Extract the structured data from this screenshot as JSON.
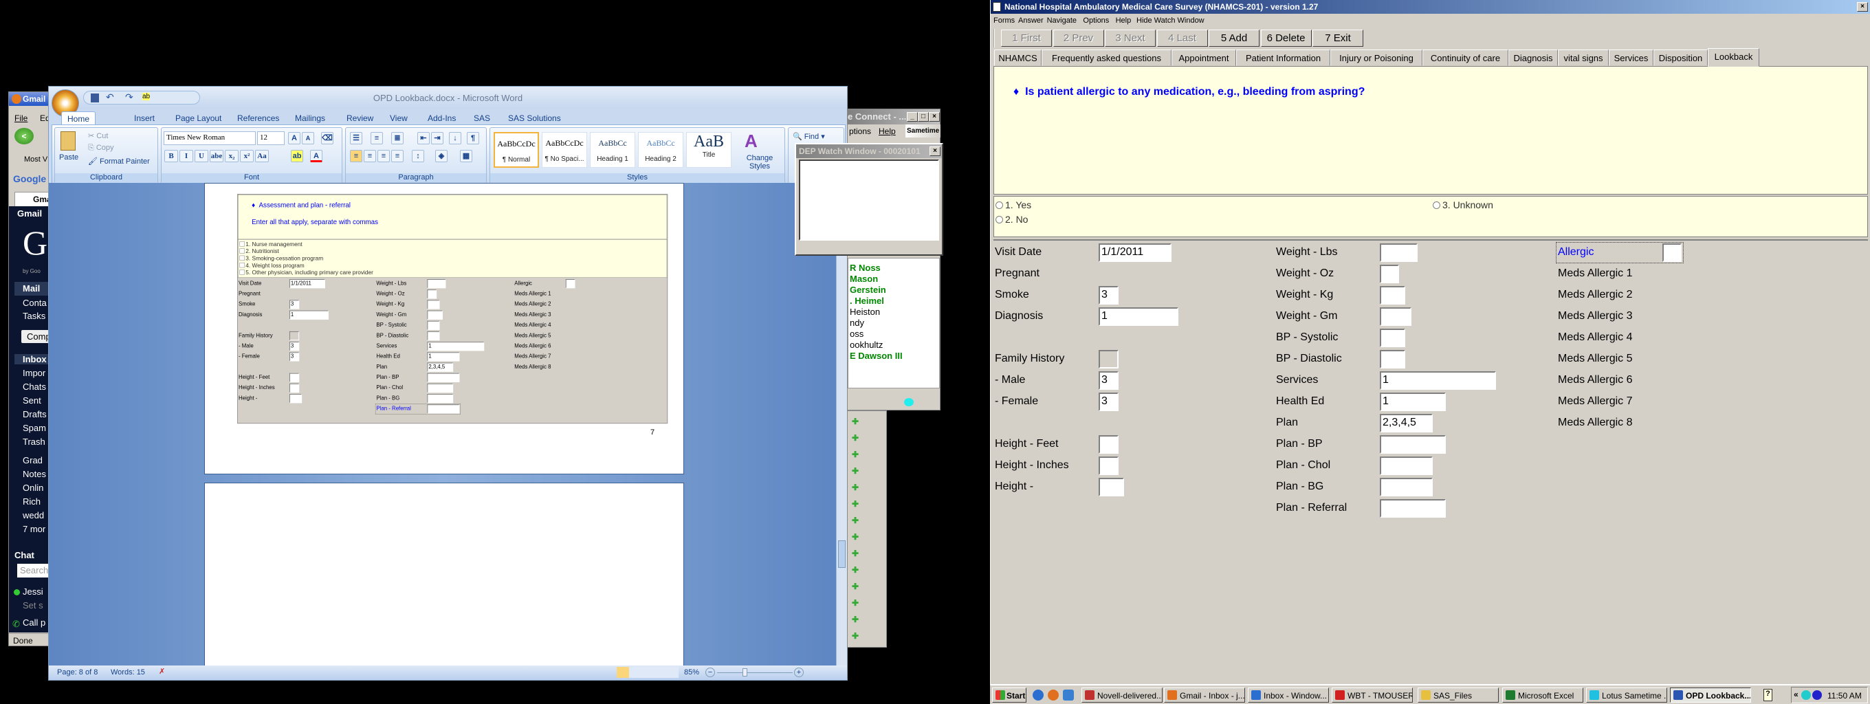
{
  "gmail_window": {
    "title": "Gmail",
    "menu": [
      "File",
      "Edit"
    ],
    "bookmark": "Most V",
    "search_logo": "Google",
    "tab": "Gma",
    "header": "Gmail",
    "logo": "G",
    "logo_sub": "by Goo",
    "nav": [
      "Mail",
      "Conta",
      "Tasks"
    ],
    "compose": "Comp",
    "folders": [
      "Inbox",
      "Impor",
      "Chats",
      "Sent",
      "Drafts",
      "Spam",
      "Trash",
      "Grad",
      "Notes",
      "Onlin",
      "Rich",
      "wedd",
      "7 mor"
    ],
    "chat_label": "Chat",
    "chat_search": "Search",
    "contact": "Jessi",
    "contact_status": "Set s",
    "call": "Call p",
    "statusbar": "Done"
  },
  "word": {
    "title": "OPD Lookback.docx - Microsoft Word",
    "tabs": [
      "Home",
      "Insert",
      "Page Layout",
      "References",
      "Mailings",
      "Review",
      "View",
      "Add-Ins",
      "SAS",
      "SAS Solutions"
    ],
    "active_tab": "Home",
    "clipboard": {
      "paste": "Paste",
      "cut": "Cut",
      "copy": "Copy",
      "format_painter": "Format Painter",
      "label": "Clipboard"
    },
    "font": {
      "name": "Times New Roman",
      "size": "12",
      "label": "Font",
      "buttons": [
        "B",
        "I",
        "U",
        "abe",
        "x₂",
        "x²",
        "Aa"
      ]
    },
    "paragraph": {
      "label": "Paragraph"
    },
    "styles": {
      "label": "Styles",
      "items": [
        {
          "preview": "AaBbCcDc",
          "label": "¶ Normal"
        },
        {
          "preview": "AaBbCcDc",
          "label": "¶ No Spaci..."
        },
        {
          "preview": "AaBbCc",
          "label": "Heading 1"
        },
        {
          "preview": "AaBbCc",
          "label": "Heading 2"
        },
        {
          "preview": "AaB",
          "label": "Title"
        }
      ],
      "change_styles": "Change Styles"
    },
    "editing": {
      "find": "Find"
    },
    "status": {
      "page": "Page: 8 of 8",
      "words": "Words: 15",
      "zoom": "85%",
      "zoom_level": 85
    },
    "embedded": {
      "question": "Assessment and plan - referral",
      "instruction": "Enter all that apply, separate with commas",
      "options": [
        "1.  Nurse management",
        "2.  Nutritionist",
        "3.  Smoking-cessation program",
        "4.  Weight loss program",
        "5.  Other physician, including primary care provider"
      ],
      "focused_field": "Plan - Referral",
      "page_number": "7"
    }
  },
  "sametime": {
    "title": "e Connect - ...",
    "menu": [
      "ptions",
      "Help"
    ],
    "logo": "Sametime",
    "contacts": [
      {
        "name": "R Noss",
        "online": true
      },
      {
        "name": "Mason",
        "online": true
      },
      {
        "name": "Gerstein",
        "online": true
      },
      {
        "name": ". Heimel",
        "online": true
      },
      {
        "name": "Heiston",
        "online": false
      },
      {
        "name": "ndy",
        "online": false
      },
      {
        "name": "oss",
        "online": false
      },
      {
        "name": "ookhultz",
        "online": false
      },
      {
        "name": "E Dawson III",
        "online": true
      }
    ]
  },
  "watch_window": {
    "title": "DEP Watch Window - 00020101"
  },
  "nhamcs": {
    "title": "National Hospital Ambulatory Medical Care Survey (NHAMCS-201) - version 1.27",
    "menu": [
      "Forms",
      "Answer",
      "Navigate",
      "Options",
      "Help",
      "Hide Watch Window"
    ],
    "toolbar": [
      {
        "label": "1 First",
        "enabled": false
      },
      {
        "label": "2 Prev",
        "enabled": false
      },
      {
        "label": "3 Next",
        "enabled": false
      },
      {
        "label": "4 Last",
        "enabled": false
      },
      {
        "label": "5 Add",
        "enabled": true
      },
      {
        "label": "6 Delete",
        "enabled": true
      },
      {
        "label": "7 Exit",
        "enabled": true
      }
    ],
    "tabs": [
      "NHAMCS",
      "Frequently asked questions",
      "Appointment",
      "Patient Information",
      "Injury or Poisoning",
      "Continuity of care",
      "Diagnosis",
      "vital signs",
      "Services",
      "Disposition",
      "Lookback"
    ],
    "active_tab": "Lookback",
    "question": "Is patient allergic to any medication, e.g., bleeding from aspring?",
    "options": [
      "1. Yes",
      "2. No",
      "3. Unknown"
    ],
    "focused_field": "Allergic"
  },
  "form": {
    "columns": [
      [
        {
          "label": "Visit Date",
          "value": "1/1/2011"
        },
        {
          "label": "Pregnant"
        },
        {
          "label": "Smoke",
          "value": "3"
        },
        {
          "label": "Diagnosis",
          "value": "1"
        },
        {
          "label": "Family History",
          "value": "",
          "disabled": true
        },
        {
          "label": " - Male",
          "value": "3"
        },
        {
          "label": " - Female",
          "value": "3"
        },
        {
          "label": "Height - Feet",
          "value": ""
        },
        {
          "label": "Height - Inches",
          "value": ""
        },
        {
          "label": "Height -",
          "value": ""
        }
      ],
      [
        {
          "label": "Weight - Lbs",
          "value": ""
        },
        {
          "label": "Weight - Oz",
          "value": ""
        },
        {
          "label": "Weight - Kg",
          "value": ""
        },
        {
          "label": "Weight - Gm",
          "value": ""
        },
        {
          "label": "BP - Systolic",
          "value": ""
        },
        {
          "label": "BP - Diastolic",
          "value": ""
        },
        {
          "label": "Services",
          "value": "1"
        },
        {
          "label": "Health Ed",
          "value": "1"
        },
        {
          "label": "Plan",
          "value": "2,3,4,5"
        },
        {
          "label": "Plan - BP",
          "value": ""
        },
        {
          "label": "Plan - Chol",
          "value": ""
        },
        {
          "label": "Plan - BG",
          "value": ""
        },
        {
          "label": "Plan - Referral",
          "value": ""
        }
      ],
      [
        {
          "label": "Allergic",
          "value": ""
        },
        {
          "label": "Meds Allergic 1"
        },
        {
          "label": "Meds Allergic 2"
        },
        {
          "label": "Meds Allergic 3"
        },
        {
          "label": "Meds Allergic 4"
        },
        {
          "label": "Meds Allergic 5"
        },
        {
          "label": "Meds Allergic 6"
        },
        {
          "label": "Meds Allergic 7"
        },
        {
          "label": "Meds Allergic 8"
        }
      ]
    ]
  },
  "taskbar": {
    "start": "Start",
    "items": [
      {
        "label": "Novell-delivered...",
        "color": "#c03030"
      },
      {
        "label": "Gmail - Inbox - j...",
        "color": "#e07020"
      },
      {
        "label": "Inbox - Window...",
        "color": "#2a6fd0"
      },
      {
        "label": "WBT - TMOUSER...",
        "color": "#d02020"
      },
      {
        "label": "SAS_Files",
        "color": "#e8c040"
      },
      {
        "label": "Microsoft Excel",
        "color": "#1e7b30"
      },
      {
        "label": "Lotus Sametime ...",
        "color": "#20c0e0"
      },
      {
        "label": "OPD Lookback....",
        "color": "#2a55b0",
        "active": true
      }
    ],
    "clock": "11:50 AM"
  }
}
